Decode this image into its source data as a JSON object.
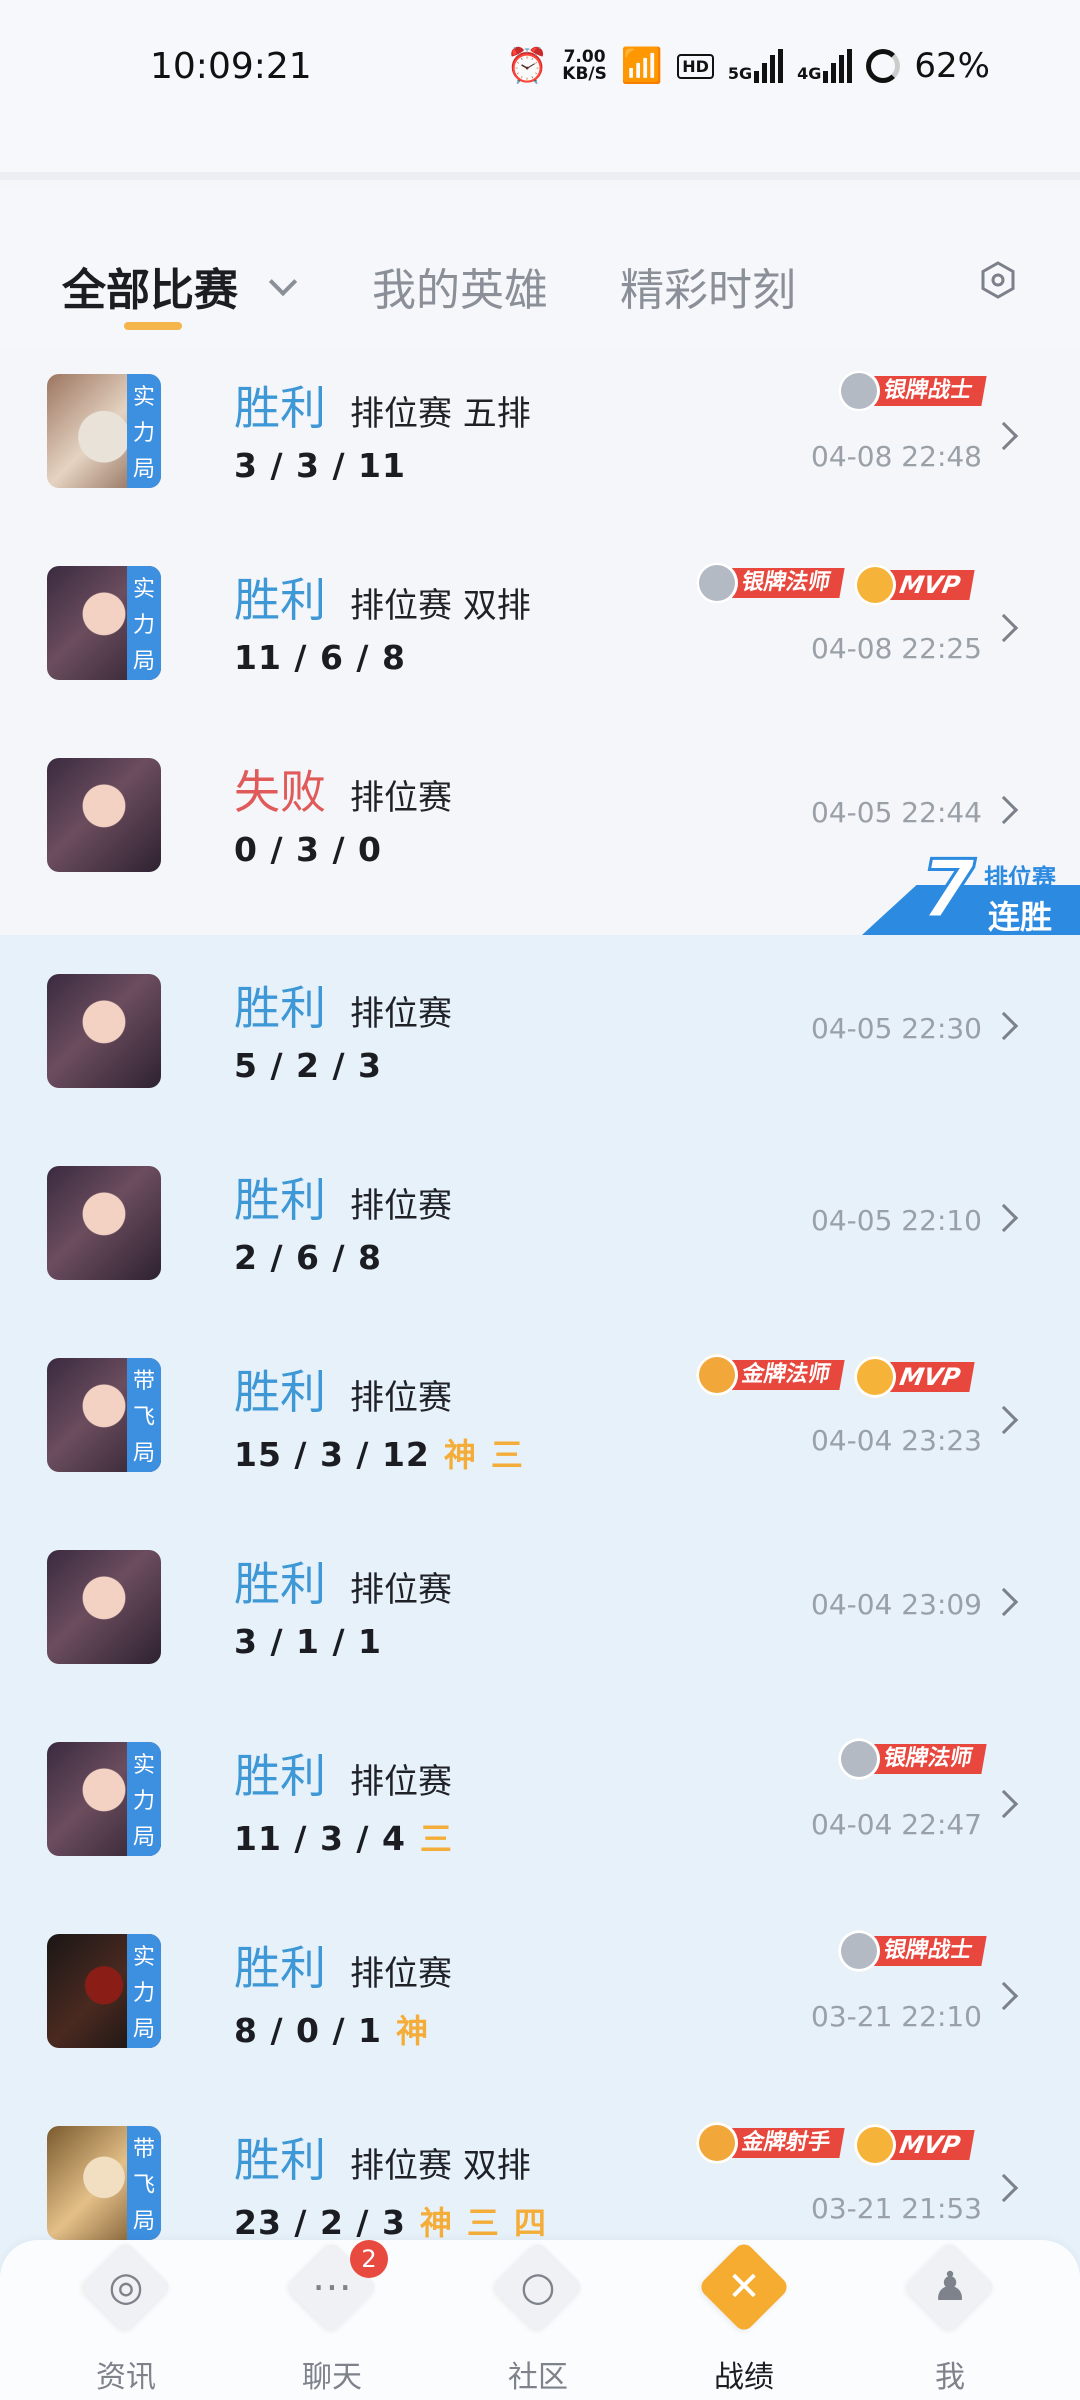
{
  "status_bar": {
    "time": "10:09:21",
    "net_speed_value": "7.00",
    "net_speed_unit": "KB/S",
    "hd": "HD",
    "signal1": "5G",
    "signal2": "4G",
    "battery": "62%"
  },
  "tabs": {
    "all": "全部比赛",
    "heroes": "我的英雄",
    "highlights": "精彩时刻"
  },
  "streak": {
    "count": "7",
    "type": "排位赛",
    "label": "连胜"
  },
  "matches": [
    {
      "result": "胜利",
      "mode": "排位赛 五排",
      "kda": "3 / 3 / 11",
      "date": "04-08 22:48",
      "ribbon": "实力局",
      "badge": "银牌战士"
    },
    {
      "result": "胜利",
      "mode": "排位赛 双排",
      "kda": "11 / 6 / 8",
      "date": "04-08 22:25",
      "ribbon": "实力局",
      "badge": "银牌法师",
      "mvp": "MVP"
    },
    {
      "result": "失败",
      "mode": "排位赛",
      "kda": "0 / 3 / 0",
      "date": "04-05 22:44"
    },
    {
      "result": "胜利",
      "mode": "排位赛",
      "kda": "5 / 2 / 3",
      "date": "04-05 22:30"
    },
    {
      "result": "胜利",
      "mode": "排位赛",
      "kda": "2 / 6 / 8",
      "date": "04-05 22:10"
    },
    {
      "result": "胜利",
      "mode": "排位赛",
      "kda": "15 / 3 / 12",
      "tag1": "神",
      "tag2": "三",
      "date": "04-04 23:23",
      "ribbon": "带飞局",
      "badge": "金牌法师",
      "mvp": "MVP"
    },
    {
      "result": "胜利",
      "mode": "排位赛",
      "kda": "3 / 1 / 1",
      "date": "04-04 23:09"
    },
    {
      "result": "胜利",
      "mode": "排位赛",
      "kda": "11 / 3 / 4",
      "tag1": "三",
      "date": "04-04 22:47",
      "ribbon": "实力局",
      "badge": "银牌法师"
    },
    {
      "result": "胜利",
      "mode": "排位赛",
      "kda": "8 / 0 / 1",
      "tag1": "神",
      "date": "03-21 22:10",
      "ribbon": "实力局",
      "badge": "银牌战士"
    },
    {
      "result": "胜利",
      "mode": "排位赛 双排",
      "kda": "23 / 2 / 3",
      "tag1": "神",
      "tag2": "三",
      "tag3": "四",
      "date": "03-21 21:53",
      "ribbon": "带飞局",
      "badge": "金牌射手",
      "mvp": "MVP"
    }
  ],
  "nav": {
    "news": "资讯",
    "chat": "聊天",
    "chat_badge": "2",
    "community": "社区",
    "record": "战绩",
    "me": "我"
  },
  "colors": {
    "win": "#3e98d6",
    "loss": "#e05a5a",
    "accent": "#f5ac30",
    "badge_red": "#e8473e",
    "ribbon_blue": "#3d8fe0"
  }
}
